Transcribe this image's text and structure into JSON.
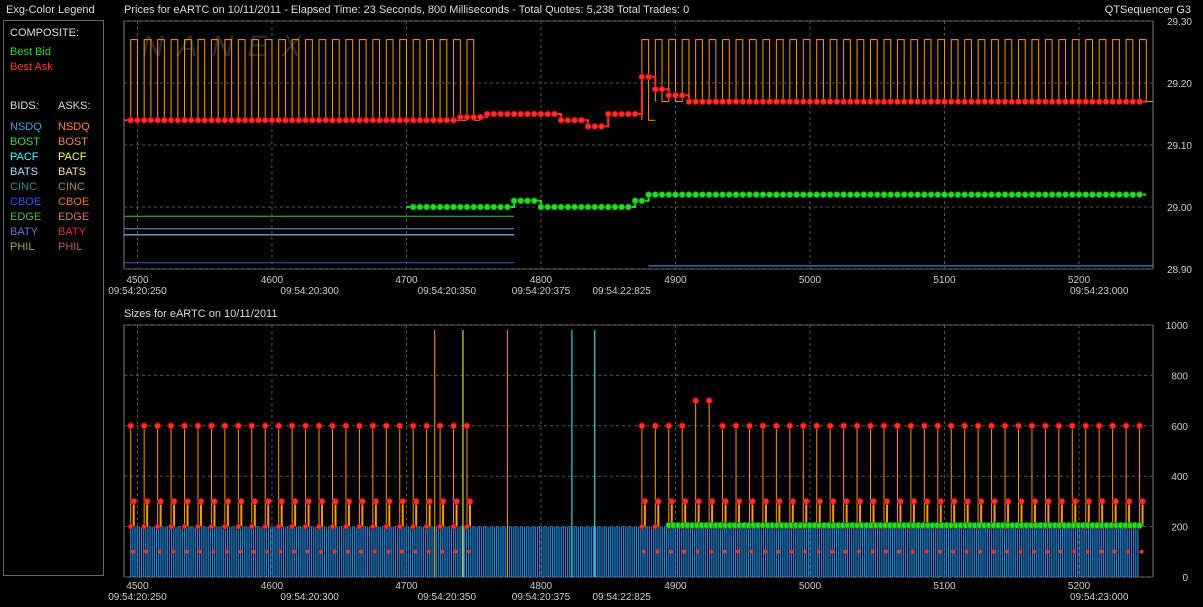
{
  "legend": {
    "title": "Exg-Color Legend",
    "composite_label": "COMPOSITE:",
    "composite": [
      {
        "label": "Best Bid",
        "color": "#22dd22"
      },
      {
        "label": "Best Ask",
        "color": "#ff3030"
      }
    ],
    "bids_label": "BIDS:",
    "asks_label": "ASKS:",
    "rows": [
      {
        "bid": "NSDQ",
        "bid_color": "#4a9ef0",
        "ask": "NSDQ",
        "ask_color": "#ff8040"
      },
      {
        "bid": "BOST",
        "bid_color": "#33dd33",
        "ask": "BOST",
        "ask_color": "#ee8844"
      },
      {
        "bid": "PACF",
        "bid_color": "#44ffff",
        "ask": "PACF",
        "ask_color": "#ffff55"
      },
      {
        "bid": "BATS",
        "bid_color": "#aaddff",
        "ask": "BATS",
        "ask_color": "#ffdd99"
      },
      {
        "bid": "CINC",
        "bid_color": "#338888",
        "ask": "CINC",
        "ask_color": "#aa8855"
      },
      {
        "bid": "CBOE",
        "bid_color": "#3355ee",
        "ask": "CBOE",
        "ask_color": "#ee7722"
      },
      {
        "bid": "EDGE",
        "bid_color": "#44bb44",
        "ask": "EDGE",
        "ask_color": "#dd7766"
      },
      {
        "bid": "BATY",
        "bid_color": "#6677dd",
        "ask": "BATY",
        "ask_color": "#dd3333"
      },
      {
        "bid": "PHIL",
        "bid_color": "#99aa44",
        "ask": "PHIL",
        "ask_color": "#cc5555"
      }
    ]
  },
  "header": {
    "prices_title": "Prices for  eARTC  on  10/11/2011  - Elapsed Time: 23 Seconds, 800 Milliseconds  -  Total Quotes: 5,238  Total Trades: 0",
    "app_name": "QTSequencer G3",
    "sizes_title": "Sizes for  eARTC  on  10/11/2011",
    "watermark": "NANEX"
  },
  "colors": {
    "best_bid": "#22dd22",
    "best_ask": "#ff3030",
    "ask_line": "#ff9900",
    "bid_bar": "#2288dd",
    "grid": "#555555",
    "axis_text": "#cccccc"
  },
  "chart_data": [
    {
      "type": "line",
      "title": "Prices for eARTC on 10/11/2011",
      "x_ticks": [
        4500,
        4600,
        4700,
        4800,
        4900,
        5000,
        5100,
        5200
      ],
      "time_labels": [
        "09:54:20:250",
        "09:54:20:300",
        "09:54:20:350",
        "09:54:20:375",
        "09:54:22:825",
        "09:54:23:000"
      ],
      "xlim": [
        4490,
        5255
      ],
      "ylim": [
        28.9,
        29.3
      ],
      "y_ticks": [
        "28.90",
        "29.00",
        "29.10",
        "29.20",
        "29.30"
      ],
      "grid": true,
      "series": [
        {
          "name": "Best Ask",
          "x": [
            4490,
            4600,
            4700,
            4740,
            4760,
            4800,
            4815,
            4835,
            4850,
            4860,
            4875,
            4885,
            4895,
            4910,
            5000,
            5100,
            5200,
            5250
          ],
          "values": [
            29.14,
            29.14,
            29.14,
            29.145,
            29.15,
            29.15,
            29.14,
            29.13,
            29.15,
            29.15,
            29.21,
            29.19,
            29.18,
            29.17,
            29.17,
            29.17,
            29.17,
            29.17
          ]
        },
        {
          "name": "Best Bid",
          "x": [
            4700,
            4740,
            4760,
            4780,
            4800,
            4830,
            4850,
            4860,
            4870,
            4880,
            4895,
            4910,
            5000,
            5100,
            5200,
            5250
          ],
          "values": [
            29.0,
            29.0,
            29.0,
            29.01,
            29.0,
            29.0,
            29.0,
            29.0,
            29.01,
            29.02,
            29.02,
            29.02,
            29.02,
            29.02,
            29.02,
            29.02
          ]
        }
      ]
    },
    {
      "type": "bar",
      "title": "Sizes for eARTC on 10/11/2011",
      "x_ticks": [
        4500,
        4600,
        4700,
        4800,
        4900,
        5000,
        5100,
        5200
      ],
      "time_labels": [
        "09:54:20:250",
        "09:54:20:300",
        "09:54:20:350",
        "09:54:20:375",
        "09:54:22:825",
        "09:54:23:000"
      ],
      "xlim": [
        4490,
        5255
      ],
      "ylim": [
        0,
        1000
      ],
      "y_ticks": [
        0,
        200,
        400,
        600,
        800,
        1000
      ],
      "grid": true,
      "series": [
        {
          "name": "Best Ask",
          "description": "ask size alternates between 300 and 600, spike to 700 near 4920",
          "typical_values": [
            300,
            600
          ],
          "max": 700
        },
        {
          "name": "Best Bid",
          "description": "bid size steady at 200",
          "typical_values": [
            200
          ]
        }
      ]
    }
  ]
}
